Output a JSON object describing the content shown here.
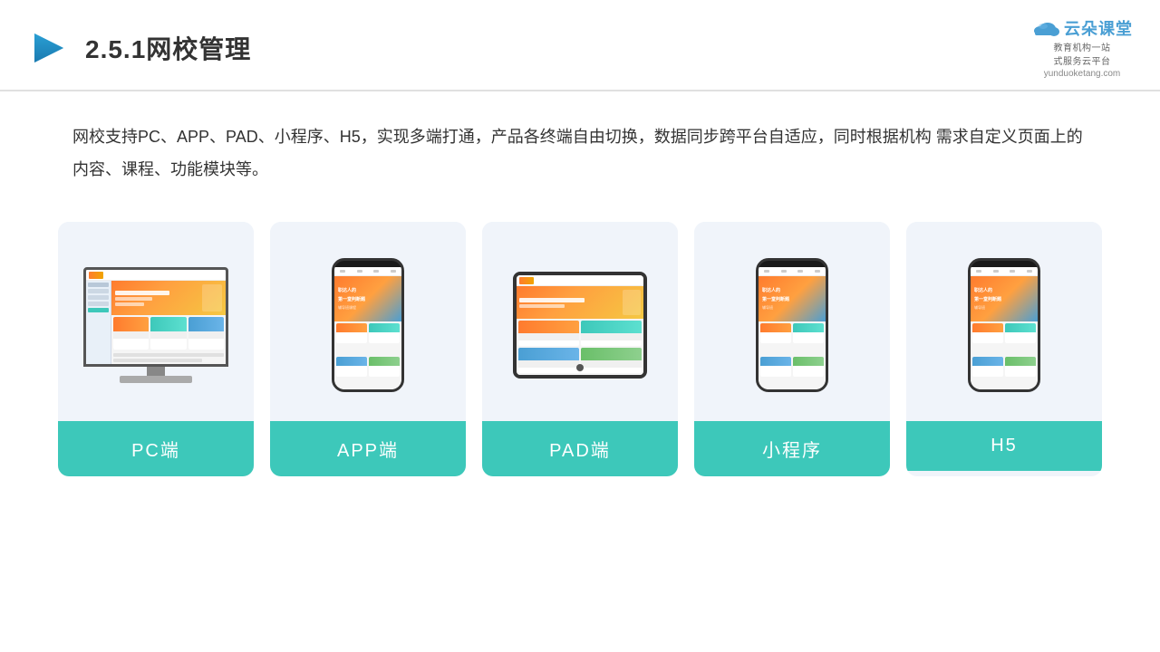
{
  "header": {
    "title": "2.5.1网校管理",
    "brand_name": "云朵课堂",
    "brand_tagline": "教育机构一站\n式服务云平台",
    "brand_url": "yunduoketang.com"
  },
  "description": {
    "text": "网校支持PC、APP、PAD、小程序、H5，实现多端打通，产品各终端自由切换，数据同步跨平台自适应，同时根据机构\n需求自定义页面上的内容、课程、功能模块等。"
  },
  "cards": [
    {
      "id": "pc",
      "label": "PC端"
    },
    {
      "id": "app",
      "label": "APP端"
    },
    {
      "id": "pad",
      "label": "PAD端"
    },
    {
      "id": "miniapp",
      "label": "小程序"
    },
    {
      "id": "h5",
      "label": "H5"
    }
  ],
  "colors": {
    "teal": "#3dc8ba",
    "accent": "#4a9fd4",
    "orange": "#ff7b2e",
    "header_line": "#e0e0e0"
  }
}
